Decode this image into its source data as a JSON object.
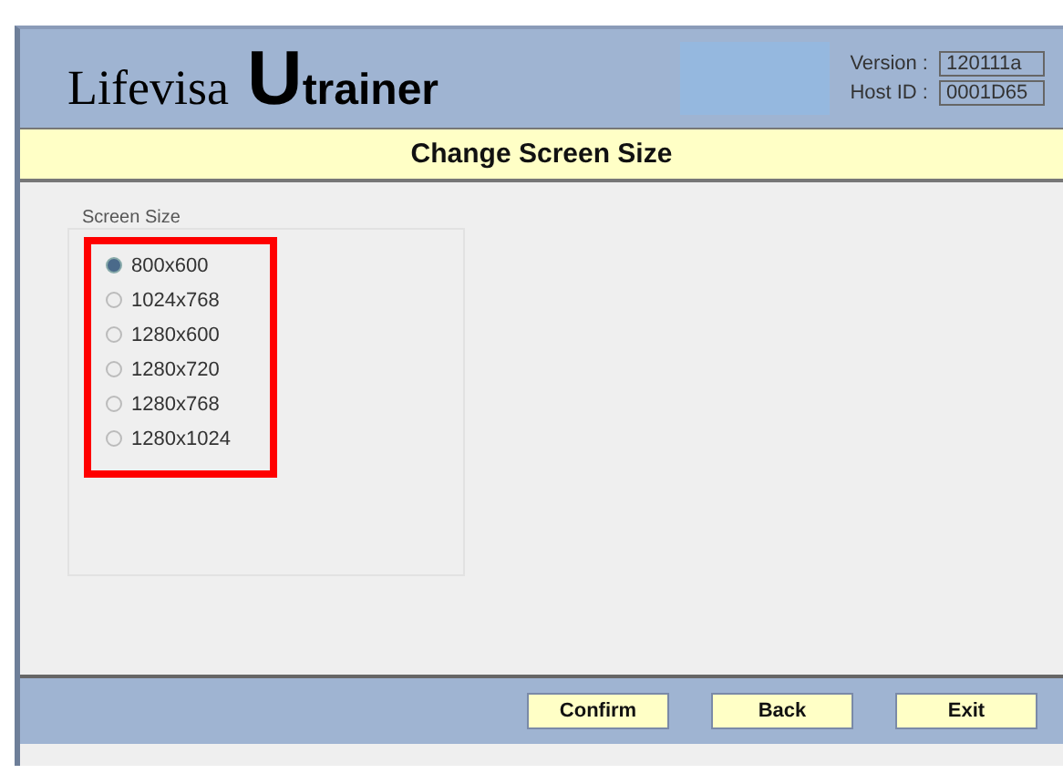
{
  "header": {
    "logo": {
      "brand": "Lifevisa",
      "initial": "U",
      "rest": "trainer"
    },
    "info": [
      {
        "label": "Version :",
        "value": "120111a"
      },
      {
        "label": "Host ID :",
        "value": "0001D65"
      }
    ]
  },
  "title": "Change Screen Size",
  "group": {
    "label": "Screen Size",
    "options": [
      {
        "label": "800x600",
        "selected": true
      },
      {
        "label": "1024x768",
        "selected": false
      },
      {
        "label": "1280x600",
        "selected": false
      },
      {
        "label": "1280x720",
        "selected": false
      },
      {
        "label": "1280x768",
        "selected": false
      },
      {
        "label": "1280x1024",
        "selected": false
      }
    ]
  },
  "buttons": [
    "Confirm",
    "Back",
    "Exit"
  ]
}
